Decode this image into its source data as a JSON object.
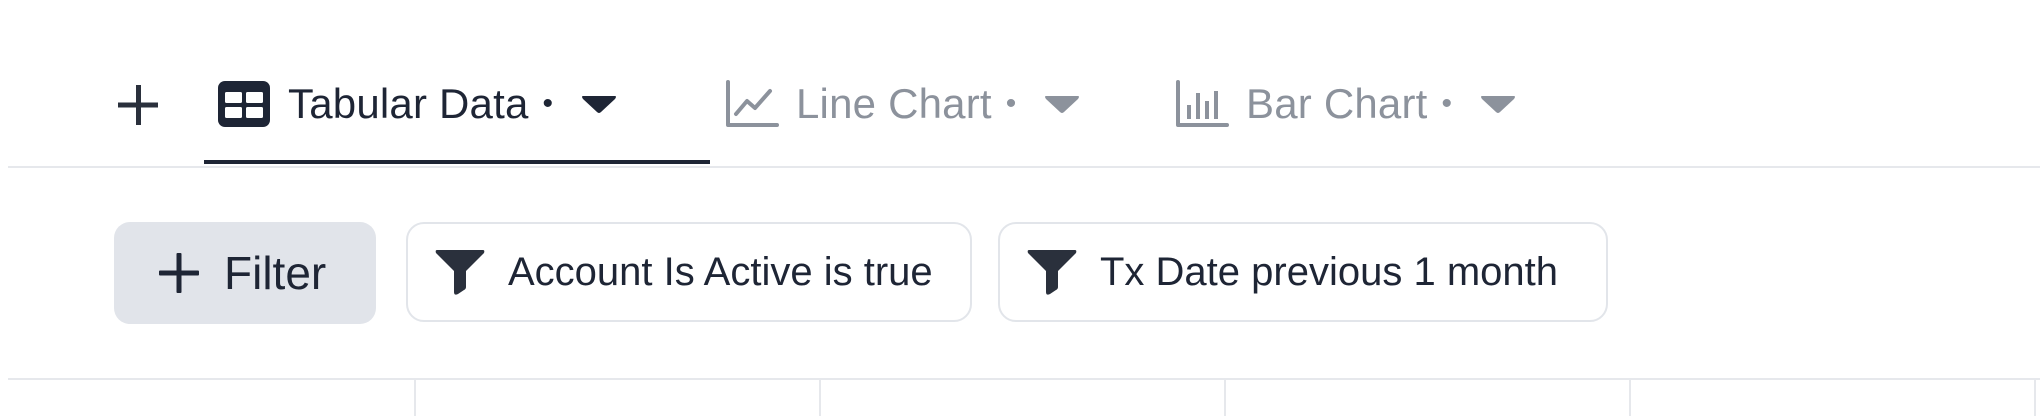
{
  "tabs": [
    {
      "label": "Tabular Data",
      "dot": "•",
      "icon": "table-icon",
      "active": true
    },
    {
      "label": "Line Chart",
      "dot": "•",
      "icon": "line-chart-icon",
      "active": false
    },
    {
      "label": "Bar Chart",
      "dot": "•",
      "icon": "bar-chart-icon",
      "active": false
    }
  ],
  "toolbar": {
    "add_icon": "plus-icon",
    "filter_label": "Filter"
  },
  "filters": [
    {
      "label": "Account Is Active is true",
      "icon": "funnel-icon"
    },
    {
      "label": "Tx Date previous 1 month",
      "icon": "funnel-icon"
    }
  ],
  "colors": {
    "text": "#1e2535",
    "muted": "#8c929c",
    "filter_bg": "#e1e4ea",
    "border": "#e6e8ec"
  }
}
